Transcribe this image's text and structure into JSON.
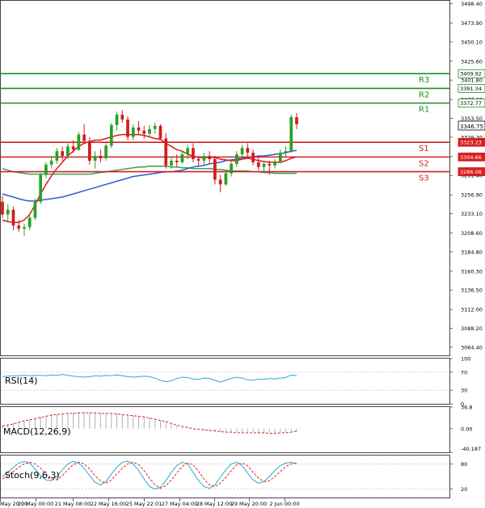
{
  "chart_data": {
    "type": "candlestick",
    "main_axis": {
      "ylim": [
        3054.0,
        3502.0
      ],
      "ticks": [
        "3498.40",
        "3473.90",
        "3450.10",
        "3425.60",
        "3401.80",
        "3377.30",
        "3353.50",
        "3329.70",
        "3305.20",
        "3281.40",
        "3256.90",
        "3233.10",
        "3208.60",
        "3184.80",
        "3160.30",
        "3136.50",
        "3112.00",
        "3088.20",
        "3064.40"
      ]
    },
    "x_axis": {
      "tick_labels": [
        "May 20:00",
        "20 May 00:00",
        "21 May 08:00",
        "22 May 16:00",
        "25 May 22:01",
        "27 May 04:00",
        "28 May 12:00",
        "29 May 20:00",
        "2 Jun 00:00"
      ]
    },
    "current_price": {
      "label": "3346.75",
      "value": 3346.75
    },
    "levels": [
      {
        "name": "R3",
        "label": "3409.92",
        "value": 3409.92,
        "color": "#1e8f1e"
      },
      {
        "name": "R2",
        "label": "3391.34",
        "value": 3391.34,
        "color": "#1e8f1e"
      },
      {
        "name": "R1",
        "label": "3372.77",
        "value": 3372.77,
        "color": "#1e8f1e"
      },
      {
        "name": "S1",
        "label": "3323.23",
        "value": 3323.23,
        "color": "#d42020"
      },
      {
        "name": "S2",
        "label": "3304.66",
        "value": 3304.66,
        "color": "#d42020"
      },
      {
        "name": "S3",
        "label": "3286.08",
        "value": 3286.08,
        "color": "#d42020"
      }
    ],
    "candles": [
      [
        3248,
        3255,
        3228,
        3232
      ],
      [
        3232,
        3245,
        3222,
        3238
      ],
      [
        3238,
        3242,
        3212,
        3218
      ],
      [
        3218,
        3225,
        3210,
        3214
      ],
      [
        3214,
        3220,
        3205,
        3216
      ],
      [
        3216,
        3232,
        3212,
        3228
      ],
      [
        3228,
        3252,
        3225,
        3248
      ],
      [
        3248,
        3284,
        3245,
        3282
      ],
      [
        3282,
        3298,
        3278,
        3295
      ],
      [
        3295,
        3306,
        3290,
        3300
      ],
      [
        3300,
        3316,
        3296,
        3312
      ],
      [
        3312,
        3318,
        3300,
        3306
      ],
      [
        3306,
        3322,
        3302,
        3318
      ],
      [
        3318,
        3326,
        3310,
        3314
      ],
      [
        3314,
        3336,
        3312,
        3333
      ],
      [
        3333,
        3346,
        3322,
        3325
      ],
      [
        3325,
        3330,
        3295,
        3300
      ],
      [
        3300,
        3312,
        3290,
        3306
      ],
      [
        3306,
        3314,
        3298,
        3303
      ],
      [
        3303,
        3322,
        3300,
        3319
      ],
      [
        3319,
        3348,
        3316,
        3345
      ],
      [
        3345,
        3362,
        3338,
        3358
      ],
      [
        3358,
        3364,
        3348,
        3352
      ],
      [
        3352,
        3356,
        3326,
        3330
      ],
      [
        3330,
        3346,
        3326,
        3342
      ],
      [
        3342,
        3350,
        3332,
        3338
      ],
      [
        3338,
        3344,
        3328,
        3334
      ],
      [
        3334,
        3345,
        3330,
        3340
      ],
      [
        3340,
        3348,
        3334,
        3344
      ],
      [
        3344,
        3346,
        3326,
        3328
      ],
      [
        3328,
        3335,
        3290,
        3294
      ],
      [
        3294,
        3305,
        3290,
        3300
      ],
      [
        3300,
        3308,
        3292,
        3298
      ],
      [
        3298,
        3312,
        3296,
        3308
      ],
      [
        3308,
        3320,
        3302,
        3316
      ],
      [
        3316,
        3322,
        3298,
        3302
      ],
      [
        3302,
        3306,
        3292,
        3300
      ],
      [
        3300,
        3310,
        3294,
        3306
      ],
      [
        3306,
        3312,
        3296,
        3302
      ],
      [
        3302,
        3306,
        3270,
        3276
      ],
      [
        3276,
        3282,
        3260,
        3270
      ],
      [
        3270,
        3288,
        3268,
        3284
      ],
      [
        3284,
        3300,
        3280,
        3296
      ],
      [
        3296,
        3312,
        3292,
        3308
      ],
      [
        3308,
        3320,
        3302,
        3316
      ],
      [
        3316,
        3322,
        3304,
        3310
      ],
      [
        3310,
        3314,
        3294,
        3298
      ],
      [
        3298,
        3304,
        3288,
        3292
      ],
      [
        3292,
        3300,
        3286,
        3296
      ],
      [
        3296,
        3300,
        3282,
        3294
      ],
      [
        3294,
        3302,
        3290,
        3298
      ],
      [
        3298,
        3314,
        3296,
        3310
      ],
      [
        3310,
        3318,
        3304,
        3312
      ],
      [
        3312,
        3358,
        3310,
        3355
      ],
      [
        3355,
        3360,
        3340,
        3346
      ]
    ],
    "ma_red": [
      3225,
      3223,
      3222,
      3222,
      3225,
      3232,
      3244,
      3258,
      3270,
      3281,
      3290,
      3298,
      3306,
      3312,
      3318,
      3322,
      3324,
      3326,
      3326,
      3328,
      3330,
      3332,
      3333,
      3333,
      3333,
      3333,
      3332,
      3330,
      3328,
      3327,
      3322,
      3318,
      3314,
      3312,
      3308,
      3306,
      3304,
      3304,
      3304,
      3304,
      3302,
      3301,
      3300,
      3300,
      3302,
      3303,
      3302,
      3300,
      3299,
      3298,
      3298,
      3298,
      3300,
      3303,
      3305
    ],
    "ma_blue": [
      3258,
      3256,
      3254,
      3252,
      3250,
      3249,
      3249,
      3250,
      3251,
      3252,
      3253,
      3254,
      3256,
      3258,
      3260,
      3262,
      3264,
      3266,
      3268,
      3270,
      3272,
      3274,
      3276,
      3278,
      3280,
      3281,
      3282,
      3283,
      3284,
      3285,
      3286,
      3286,
      3287,
      3288,
      3290,
      3292,
      3293,
      3294,
      3296,
      3297,
      3298,
      3300,
      3301,
      3302,
      3303,
      3304,
      3305,
      3306,
      3306,
      3307,
      3308,
      3309,
      3310,
      3312,
      3313
    ],
    "ma_green": [
      3290,
      3288,
      3286,
      3285,
      3284,
      3283,
      3283,
      3283,
      3283,
      3283,
      3283,
      3283,
      3283,
      3283,
      3283,
      3283,
      3283,
      3284,
      3285,
      3286,
      3287,
      3288,
      3289,
      3290,
      3291,
      3292,
      3292,
      3293,
      3293,
      3293,
      3293,
      3292,
      3292,
      3291,
      3291,
      3290,
      3290,
      3290,
      3290,
      3289,
      3289,
      3288,
      3287,
      3287,
      3287,
      3287,
      3286,
      3286,
      3285,
      3285,
      3284,
      3284,
      3284,
      3284,
      3284
    ],
    "rsi": {
      "label": "RSI(14)",
      "ticks": [
        "100",
        "70",
        "30",
        "0"
      ],
      "values": [
        60,
        61,
        62,
        62,
        63,
        62,
        63,
        63,
        62,
        64,
        63,
        65,
        63,
        61,
        60,
        59,
        60,
        62,
        61,
        63,
        62,
        64,
        62,
        60,
        59,
        60,
        61,
        60,
        57,
        52,
        49,
        51,
        56,
        59,
        58,
        55,
        54,
        57,
        56,
        52,
        48,
        52,
        56,
        59,
        57,
        53,
        52,
        55,
        54,
        56,
        55,
        57,
        58,
        64,
        62
      ]
    },
    "macd": {
      "label": "MACD(12,26,9)",
      "ticks": [
        "36.8",
        "0.00",
        "-40.187"
      ],
      "hist": [
        6,
        8,
        10,
        12,
        14,
        16,
        18,
        20,
        22,
        24,
        25,
        26,
        27,
        27,
        28,
        28,
        28,
        27,
        27,
        27,
        26,
        26,
        25,
        24,
        23,
        22,
        21,
        19,
        17,
        14,
        11,
        8,
        5,
        3,
        1,
        0,
        -1,
        -2,
        -3,
        -4,
        -5,
        -5,
        -6,
        -6,
        -6,
        -6,
        -6,
        -7,
        -7,
        -7,
        -7,
        -6,
        -6,
        -5,
        -5
      ],
      "signal": [
        4,
        6,
        8,
        11,
        13,
        15,
        17,
        19,
        21,
        23,
        24,
        25,
        26,
        26,
        27,
        27,
        27,
        27,
        26,
        26,
        26,
        25,
        24,
        23,
        22,
        21,
        20,
        18,
        16,
        14,
        12,
        9,
        6,
        4,
        2,
        0,
        -1,
        -2,
        -3,
        -4,
        -5,
        -6,
        -6,
        -7,
        -7,
        -7,
        -7,
        -7,
        -7,
        -8,
        -8,
        -7,
        -7,
        -6,
        -4
      ]
    },
    "stoch": {
      "label": "Stoch(9,6,3)",
      "ticks": [
        "80",
        "20"
      ],
      "k": [
        50,
        60,
        72,
        82,
        86,
        82,
        68,
        52,
        42,
        40,
        50,
        66,
        80,
        86,
        82,
        70,
        52,
        36,
        30,
        38,
        56,
        72,
        84,
        86,
        80,
        64,
        44,
        26,
        20,
        24,
        40,
        60,
        76,
        84,
        80,
        60,
        40,
        26,
        22,
        30,
        48,
        66,
        80,
        84,
        76,
        58,
        42,
        34,
        38,
        50,
        64,
        76,
        82,
        84,
        80
      ],
      "d": [
        44,
        52,
        62,
        72,
        80,
        84,
        80,
        70,
        56,
        44,
        42,
        52,
        66,
        78,
        84,
        80,
        68,
        52,
        40,
        34,
        42,
        56,
        70,
        80,
        84,
        78,
        64,
        46,
        30,
        22,
        28,
        42,
        58,
        74,
        82,
        78,
        62,
        44,
        30,
        26,
        34,
        48,
        64,
        78,
        82,
        76,
        60,
        46,
        38,
        40,
        50,
        62,
        74,
        80,
        82
      ]
    }
  }
}
